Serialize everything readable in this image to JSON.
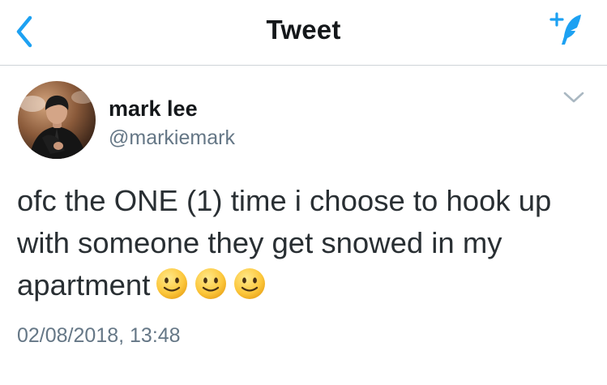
{
  "header": {
    "title": "Tweet",
    "back_icon": "chevron-left-icon",
    "compose_icon": "compose-tweet-icon"
  },
  "tweet": {
    "display_name": "mark lee",
    "handle": "@markiemark",
    "text": "ofc the ONE (1) time i choose to hook up with someone they get snowed in my apartment",
    "emojis": [
      "slightly-smiling-face",
      "slightly-smiling-face",
      "slightly-smiling-face"
    ],
    "timestamp": "02/08/2018, 13:48"
  },
  "colors": {
    "accent": "#1da1f2",
    "text": "#14171a",
    "secondary_text": "#657786",
    "divider": "#cfd4d8"
  }
}
